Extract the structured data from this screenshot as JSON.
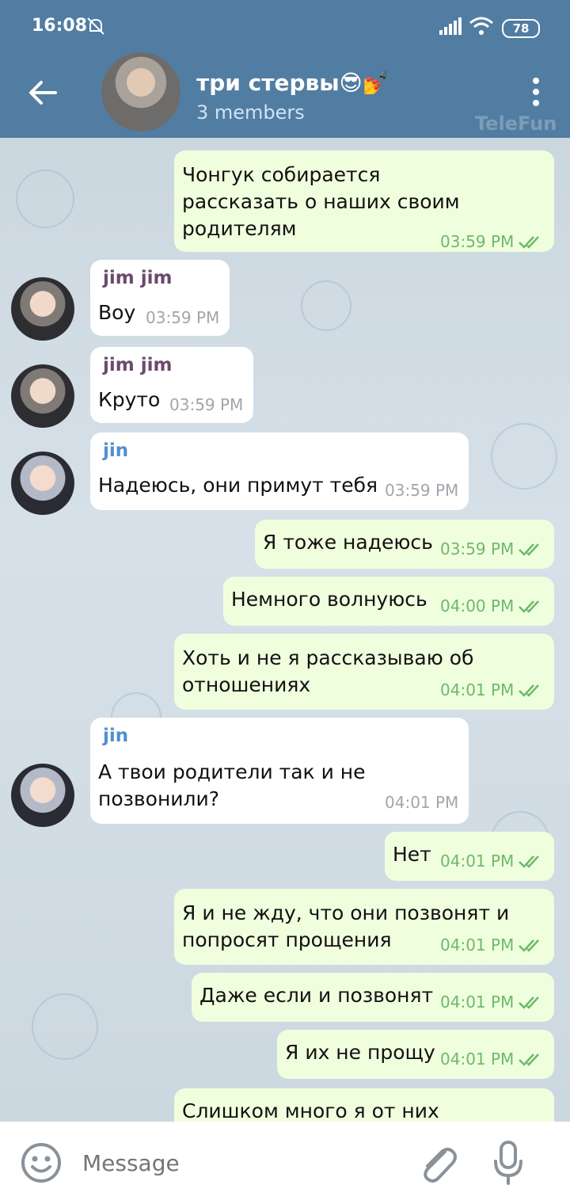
{
  "status_bar": {
    "time": "16:08",
    "battery": "78",
    "icons": [
      "bell-off-icon",
      "signal-icon",
      "wifi-icon",
      "battery-icon"
    ]
  },
  "header": {
    "title": "три стервы😎💅",
    "subtitle": "3 members",
    "watermark": "TeleFun",
    "icons": [
      "back-arrow-icon",
      "more-vertical-icon"
    ]
  },
  "messages": [
    {
      "dir": "out",
      "text": "Чонгук собирается\nрассказать о наших своим\nродителям",
      "time": "03:59 PM"
    },
    {
      "dir": "in",
      "sender": "jim jim",
      "text": "Воу",
      "time": "03:59 PM"
    },
    {
      "dir": "in",
      "sender": "jim jim",
      "text": "Круто",
      "time": "03:59 PM"
    },
    {
      "dir": "in",
      "sender": "jin",
      "text": "Надеюсь, они примут тебя",
      "time": "03:59 PM"
    },
    {
      "dir": "out",
      "text": "Я тоже надеюсь",
      "time": "03:59 PM"
    },
    {
      "dir": "out",
      "text": "Немного волнуюсь",
      "time": "04:00 PM"
    },
    {
      "dir": "out",
      "text": "Хоть и не я рассказываю об\nотношениях",
      "time": "04:01 PM"
    },
    {
      "dir": "in",
      "sender": "jin",
      "text": "А твои родители так и не\nпозвонили?",
      "time": "04:01 PM"
    },
    {
      "dir": "out",
      "text": "Нет",
      "time": "04:01 PM"
    },
    {
      "dir": "out",
      "text": "Я и не жду, что они позвонят и\nпопросят прощения",
      "time": "04:01 PM"
    },
    {
      "dir": "out",
      "text": "Даже если и позвонят",
      "time": "04:01 PM"
    },
    {
      "dir": "out",
      "text": "Я их не прощу",
      "time": "04:01 PM"
    },
    {
      "dir": "out",
      "text": "Слишком много я от них",
      "time": ""
    }
  ],
  "composer": {
    "placeholder": "Message",
    "icons": [
      "emoji-icon",
      "attach-icon",
      "mic-icon"
    ]
  },
  "colors": {
    "header": "#517da2",
    "outgoing_bubble": "#efffde",
    "incoming_bubble": "#ffffff",
    "check": "#6eb86b"
  }
}
